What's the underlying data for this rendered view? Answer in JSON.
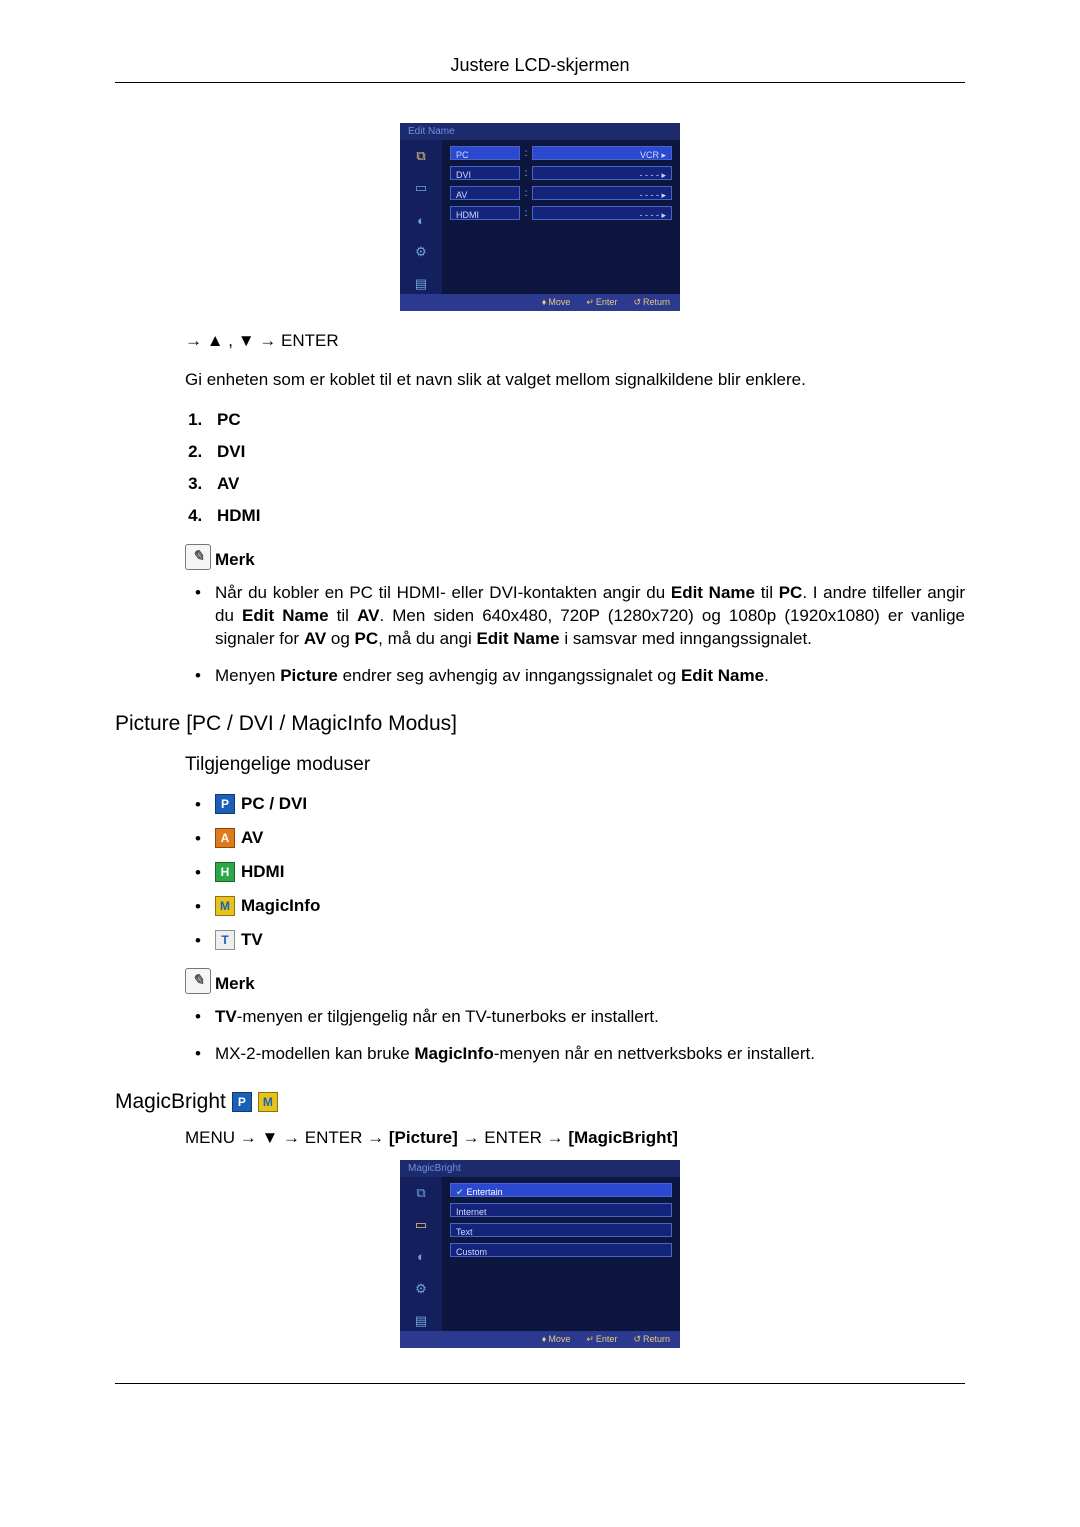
{
  "header": {
    "title": "Justere LCD-skjermen"
  },
  "osd1": {
    "title": "Edit Name",
    "rows": [
      {
        "label": "PC",
        "value": "VCR  ▸",
        "highlight": true
      },
      {
        "label": "DVI",
        "value": "- - - -   ▸"
      },
      {
        "label": "AV",
        "value": "- - - -   ▸"
      },
      {
        "label": "HDMI",
        "value": "- - - -   ▸"
      }
    ],
    "footer": {
      "move": "Move",
      "enter": "Enter",
      "return": "Return"
    }
  },
  "nav1": "→ ▲ , ▼ → ENTER",
  "intro": "Gi enheten som er koblet til et navn slik at valget mellom signalkildene blir enklere.",
  "numlist": [
    "PC",
    "DVI",
    "AV",
    "HDMI"
  ],
  "merk_label": "Merk",
  "notes1": [
    {
      "pre": "Når du kobler en PC til HDMI- eller DVI-kontakten angir du ",
      "b1": "Edit Name",
      "mid1": " til ",
      "b2": "PC",
      "mid2": ". I andre tilfeller angir du ",
      "b3": "Edit Name",
      "mid3": " til ",
      "b4": "AV",
      "mid4": ". Men siden 640x480, 720P (1280x720) og 1080p (1920x1080) er vanlige signaler for ",
      "b5": "AV",
      "mid5": " og ",
      "b6": "PC",
      "mid6": ", må du angi ",
      "b7": "Edit Name",
      "end": " i samsvar med inngangssignalet."
    },
    {
      "pre": "Menyen ",
      "b1": "Picture",
      "mid1": " endrer seg avhengig av inngangssignalet og ",
      "b2": "Edit Name",
      "end": "."
    }
  ],
  "section_picture": "Picture [PC / DVI / MagicInfo Modus]",
  "sub_modes": "Tilgjengelige moduser",
  "modes": [
    {
      "badge": "P",
      "cls": "p",
      "label": "PC / DVI"
    },
    {
      "badge": "A",
      "cls": "a",
      "label": "AV"
    },
    {
      "badge": "H",
      "cls": "h",
      "label": "HDMI"
    },
    {
      "badge": "M",
      "cls": "m",
      "label": "MagicInfo"
    },
    {
      "badge": "T",
      "cls": "t",
      "label": "TV"
    }
  ],
  "notes2": [
    {
      "pre": "",
      "b1": "TV",
      "mid1": "-menyen er tilgjengelig når en TV-tunerboks er installert.",
      "end": ""
    },
    {
      "pre": "MX-2-modellen kan bruke ",
      "b1": "MagicInfo",
      "mid1": "-menyen når en nettverksboks er installert.",
      "end": ""
    }
  ],
  "magicbright": {
    "title": "MagicBright",
    "path": {
      "p1": "MENU → ▼ → ENTER → ",
      "b1": "[Picture]",
      "p2": " → ENTER → ",
      "b2": "[MagicBright]"
    }
  },
  "osd2": {
    "title": "MagicBright",
    "options": [
      {
        "label": "Entertain",
        "checked": true,
        "highlight": true
      },
      {
        "label": "Internet"
      },
      {
        "label": "Text"
      },
      {
        "label": "Custom"
      }
    ],
    "footer": {
      "move": "Move",
      "enter": "Enter",
      "return": "Return"
    }
  }
}
